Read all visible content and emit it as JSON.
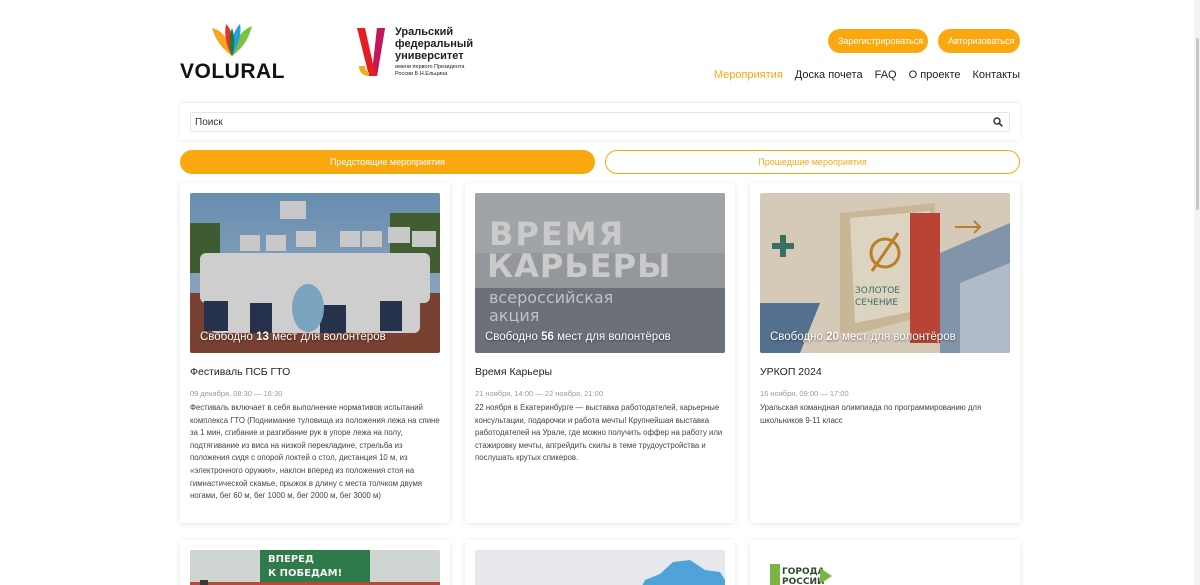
{
  "header": {
    "logo_text": "VOLURAL",
    "urfu": {
      "line1": "Уральский",
      "line2": "федеральный",
      "line3": "университет",
      "sub1": "имени первого Президента",
      "sub2": "России Б.Н.Ельцина"
    },
    "register_label": "Зарегистрироваться",
    "login_label": "Авторизоваться",
    "nav": [
      {
        "label": "Мероприятия",
        "active": true
      },
      {
        "label": "Доска почета"
      },
      {
        "label": "FAQ"
      },
      {
        "label": "О проекте"
      },
      {
        "label": "Контакты"
      }
    ]
  },
  "search": {
    "placeholder": "Поиск",
    "icon": "search-icon"
  },
  "tabs": {
    "upcoming": "Предстоящие мероприятия",
    "past": "Прошедшие мероприятия"
  },
  "colors": {
    "accent": "#f9a90f"
  },
  "events": [
    {
      "free_prefix": "Свободно",
      "free_count": "13",
      "free_suffix": "мест для волонтёров",
      "title": "Фестиваль ПСБ ГТО",
      "date": "09 декабря, 08:30 — 16:30",
      "description": "Фестиваль включает в себя выполнение нормативов испытаний комплекса ГТО (Поднимание туловища из положения лежа на спине за 1 мин, сгибание и разгибание рук в упоре лежа на полу, подтягивание из виса на низкой перекладине, стрельба из положения сидя с опорой локтей о стол, дистанция 10 м, из «электронного оружия», наклон вперед из положения стоя на гимнастической скамье, прыжок в длину с места толчком двумя ногами, бег 60 м, бег 1000 м, бег 2000 м, бег 3000 м)"
    },
    {
      "free_prefix": "Свободно",
      "free_count": "56",
      "free_suffix": "мест для волонтёров",
      "title": "Время Карьеры",
      "date": "21 ноября, 14:00 — 22 ноября, 21:00",
      "description": "22 ноября в Екатеринбурге — выставка работодателей, карьерные консультации, подарочки и работа мечты! Крупнейшая выставка работодателей на Урале, где можно получить оффер на работу или стажировку мечты, апгрейдить скилы в теме трудоустройства и послушать крутых спикеров.",
      "image_text": {
        "l1": "ВРЕМЯ",
        "l2": "КАРЬЕРЫ",
        "l3": "всероссийская",
        "l4": "акция"
      }
    },
    {
      "free_prefix": "Свободно",
      "free_count": "20",
      "free_suffix": "мест для волонтёров",
      "title": "УРКОП 2024",
      "date": "16 ноября, 09:00 — 17:00",
      "description": "Уральская командная олимпиада по программированию для школьников 9-11 класс",
      "image_text": {
        "l1": "ЗОЛОТОЕ",
        "l2": "СЕЧЕНИЕ"
      }
    }
  ],
  "row2": {
    "card1_banner_l1": "ВПЕРЕД",
    "card1_banner_l2": "К ПОБЕДАМ!",
    "card3_logo_l1": "ГОРОДА",
    "card3_logo_l2": "РОССИИ"
  }
}
